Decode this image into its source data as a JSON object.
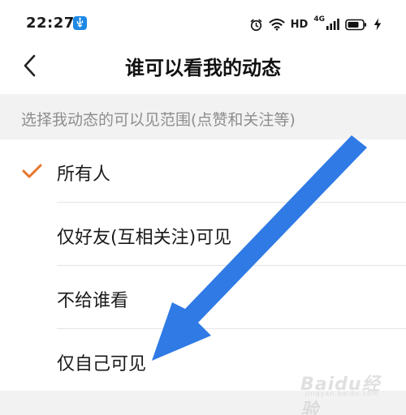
{
  "status_bar": {
    "time": "22:27",
    "network_label": "HD",
    "network_type": "4G",
    "icons": [
      "usb-icon",
      "alarm-icon",
      "wifi-icon",
      "signal-icon",
      "battery-icon",
      "charging-icon"
    ]
  },
  "header": {
    "back_icon": "chevron-left-icon",
    "title": "谁可以看我的动态"
  },
  "section": {
    "hint": "选择我动态的可以见范围(点赞和关注等)"
  },
  "options": [
    {
      "label": "所有人",
      "selected": true
    },
    {
      "label": "仅好友(互相关注)可见",
      "selected": false
    },
    {
      "label": "不给谁看",
      "selected": false
    },
    {
      "label": "仅自己可见",
      "selected": false
    }
  ],
  "colors": {
    "check": "#e8742a",
    "annotation_arrow": "#2f7ae5",
    "hint_background": "#f2f2f2",
    "usb_badge": "#1e88e5"
  },
  "watermark": {
    "text": "Baidu经验",
    "sub": "jingyan.baidu.com"
  }
}
